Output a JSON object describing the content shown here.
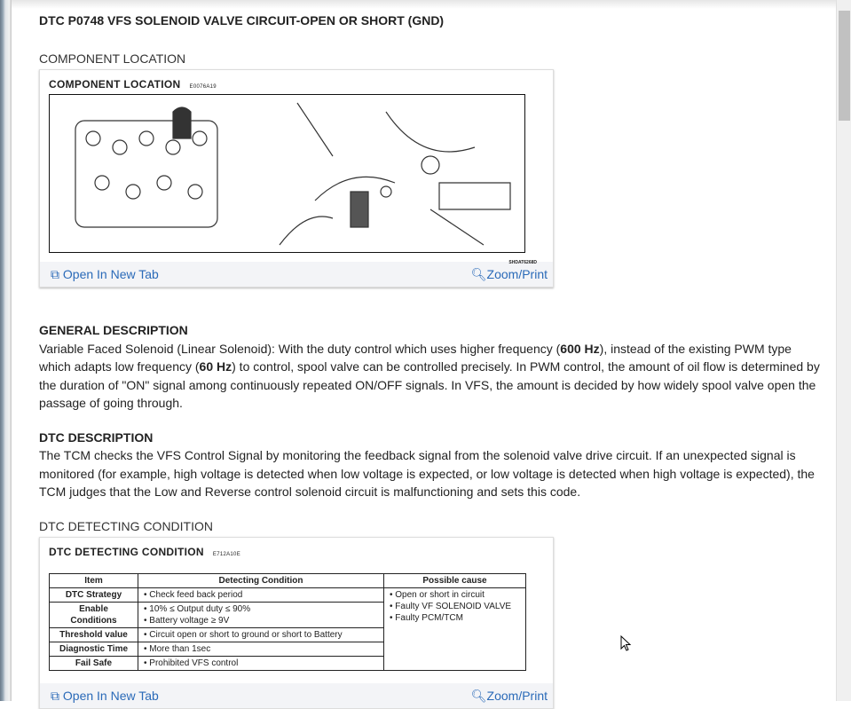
{
  "title": "DTC P0748 VFS SOLENOID VALVE CIRCUIT-OPEN OR SHORT (GND)",
  "component_location": {
    "heading": "COMPONENT LOCATION",
    "figure_title": "COMPONENT LOCATION",
    "figure_code": "E0076A19",
    "figure_ref": "SHDAT6268D",
    "open_tab": "Open In New Tab",
    "zoom_print": "Zoom/Print"
  },
  "general": {
    "heading": "GENERAL DESCRIPTION",
    "t1": " Variable Faced Solenoid (Linear Solenoid): With the duty control which uses higher frequency (",
    "b1": "600 Hz",
    "t2": "), instead of the existing PWM type which adapts low frequency (",
    "b2": "60 Hz",
    "t3": ") to control, spool valve can be controlled precisely. In PWM control, the amount of oil flow is determined by the duration of \"ON\" signal among continuously repeated ON/OFF signals. In VFS, the amount is decided by how widely spool valve open the passage of going through."
  },
  "dtc_desc": {
    "heading": "DTC DESCRIPTION",
    "text": " The TCM checks the VFS Control Signal by monitoring the feedback signal from the solenoid valve drive circuit. If an unexpected signal is monitored (for example, high voltage is detected when low voltage is expected, or low voltage is detected when high voltage is expected), the TCM judges that the Low and Reverse control solenoid circuit is malfunctioning and sets this code."
  },
  "detecting": {
    "heading": "DTC DETECTING CONDITION",
    "figure_title": "DTC DETECTING CONDITION",
    "figure_code": "E712A10E",
    "headers": [
      "Item",
      "Detecting Condition",
      "Possible cause"
    ],
    "rows": [
      {
        "item": "DTC Strategy",
        "cond": [
          "• Check feed back period"
        ]
      },
      {
        "item": "Enable Conditions",
        "cond": [
          "• 10% ≤ Output duty ≤ 90%",
          "• Battery voltage ≥ 9V"
        ]
      },
      {
        "item": "Threshold value",
        "cond": [
          "• Circuit open or short to ground or short to Battery"
        ]
      },
      {
        "item": "Diagnostic Time",
        "cond": [
          "• More than 1sec"
        ]
      },
      {
        "item": "Fail Safe",
        "cond": [
          "• Prohibited VFS control"
        ]
      }
    ],
    "causes": [
      "• Open or short in circuit",
      "• Faulty VF SOLENOID VALVE",
      "• Faulty PCM/TCM"
    ],
    "open_tab": "Open In New Tab",
    "zoom_print": "Zoom/Print"
  }
}
